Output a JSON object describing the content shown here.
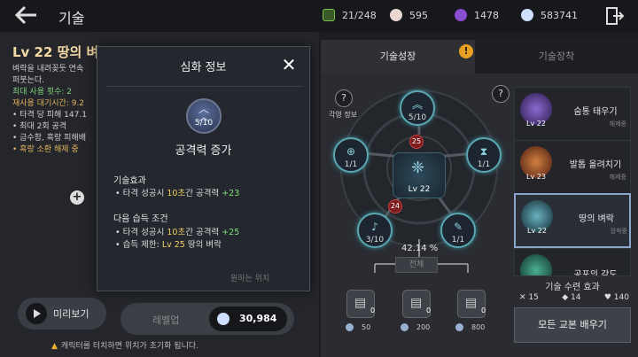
{
  "header": {
    "title": "기술",
    "resources": [
      {
        "icon": "stamina-icon",
        "value": "21/248",
        "color": "#7cc24a"
      },
      {
        "icon": "pearl-icon",
        "value": "595",
        "color": "#e8d6cf"
      },
      {
        "icon": "purple-gem-icon",
        "value": "1478",
        "color": "#8a4fd0"
      },
      {
        "icon": "silver-coin-icon",
        "value": "583741",
        "color": "#cfe0ff"
      }
    ]
  },
  "left": {
    "skill_heading": "Lv 22 땅의 벼",
    "lines": [
      {
        "text": "벼락을 내려꽂듯 연속",
        "cls": ""
      },
      {
        "text": "퍼붓는다.",
        "cls": ""
      },
      {
        "text": "최대 사용 횟수: 2",
        "cls": "g"
      },
      {
        "text": "재사용 대기시간: 9.2",
        "cls": "o"
      },
      {
        "text": "• 타격 당 피해 147.1",
        "cls": ""
      },
      {
        "text": "• 최대 2회 공격",
        "cls": ""
      },
      {
        "text": "• 금수함, 흑랑 피해배",
        "cls": ""
      },
      {
        "text": "• 흑랑 소환 해제 중",
        "cls": "o"
      }
    ],
    "preview_label": "미리보기",
    "warning": "캐릭터를 터치하면 위치가 초기화 됩니다.",
    "levelup_label": "레벨업",
    "levelup_cost": "30,984"
  },
  "popup": {
    "title": "심화 정보",
    "gem_count": "5/10",
    "skill_name": "공격력 증가",
    "effect_title": "기술효과",
    "effect_line": {
      "pre": "• 타격 성공시 ",
      "time": "10초",
      "mid": "간 공격력 ",
      "val": "+23"
    },
    "next_title": "다음 습득 조건",
    "next_line": {
      "pre": "• 타격 성공시 ",
      "time": "10초",
      "mid": "간 공격력 ",
      "val": "+25"
    },
    "req_line": {
      "pre": "• 습득 제한: ",
      "lv": "Lv 25",
      "post": " 땅의 벼락"
    },
    "hint": "원하는 위치"
  },
  "tree": {
    "tabs": [
      "기술성장",
      "기술장착"
    ],
    "badge": "!",
    "engrave_label": "각영 정보",
    "top_node": "5/10",
    "left_node": "1/1",
    "right_node": "1/1",
    "bl_node": "3/10",
    "br_node": "1/1",
    "red_top": "25",
    "red_left": "24",
    "center_level": "Lv 22",
    "percent": "42.14 %",
    "reset_label": "전체",
    "materials": [
      {
        "count": "0",
        "cost": "50"
      },
      {
        "count": "0",
        "cost": "200"
      },
      {
        "count": "0",
        "cost": "800"
      }
    ]
  },
  "skills": [
    {
      "level": "Lv 22",
      "name": "숨통 태우기",
      "status": "해제중",
      "color": "#5a3a8a"
    },
    {
      "level": "Lv 23",
      "name": "발톱 올려치기",
      "status": "해제중",
      "color": "#8a3a2a"
    },
    {
      "level": "Lv 22",
      "name": "땅의 벼락",
      "status": "장착중",
      "color": "#2a5a6a"
    },
    {
      "level": "",
      "name": "공포의 각도",
      "status": "",
      "color": "#2a5a50"
    }
  ],
  "training": {
    "title": "기술 수련 효과",
    "values": [
      "15",
      "14",
      "140"
    ]
  },
  "learn_all": "모든 교본 배우기"
}
